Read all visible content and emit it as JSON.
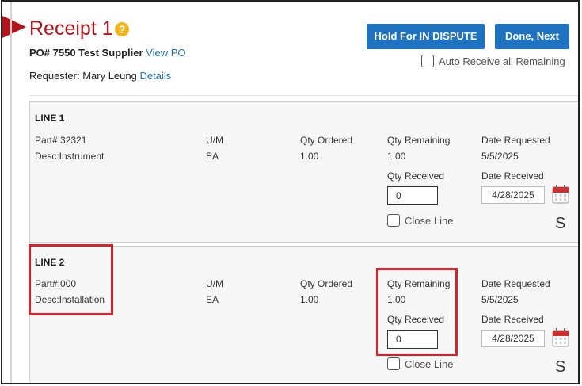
{
  "header": {
    "title": "Receipt 1",
    "help_icon": "?",
    "po_number": "PO# 7550 Test Supplier",
    "view_po": "View PO",
    "requester_label": "Requester: Mary Leung",
    "details_link": "Details"
  },
  "actions": {
    "hold_label": "Hold For IN DISPUTE",
    "done_label": "Done, Next",
    "auto_receive_label": "Auto Receive all Remaining",
    "auto_receive_checked": false
  },
  "column_headers": {
    "um": "U/M",
    "qty_ordered": "Qty Ordered",
    "qty_remaining": "Qty Remaining",
    "date_requested": "Date Requested",
    "qty_received": "Qty Received",
    "date_received": "Date Received",
    "close_line": "Close Line"
  },
  "lines": [
    {
      "label": "LINE 1",
      "part": "Part#:32321",
      "desc": "Desc:Instrument",
      "um": "EA",
      "qty_ordered": "1.00",
      "qty_remaining": "1.00",
      "date_requested": "5/5/2025",
      "qty_received": "0",
      "date_received": "4/28/2025",
      "status_letter": "S",
      "close_line_checked": false
    },
    {
      "label": "LINE 2",
      "part": "Part#:000",
      "desc": "Desc:Installation",
      "um": "EA",
      "qty_ordered": "1.00",
      "qty_remaining": "1.00",
      "date_requested": "5/5/2025",
      "qty_received": "0",
      "date_received": "4/28/2025",
      "status_letter": "S",
      "close_line_checked": false
    }
  ],
  "colors": {
    "title_red": "#b3131b",
    "button_blue": "#1f72c0",
    "link_blue": "#1f6fb0",
    "highlight_red": "#d9222a",
    "help_yellow": "#f2b41c"
  }
}
